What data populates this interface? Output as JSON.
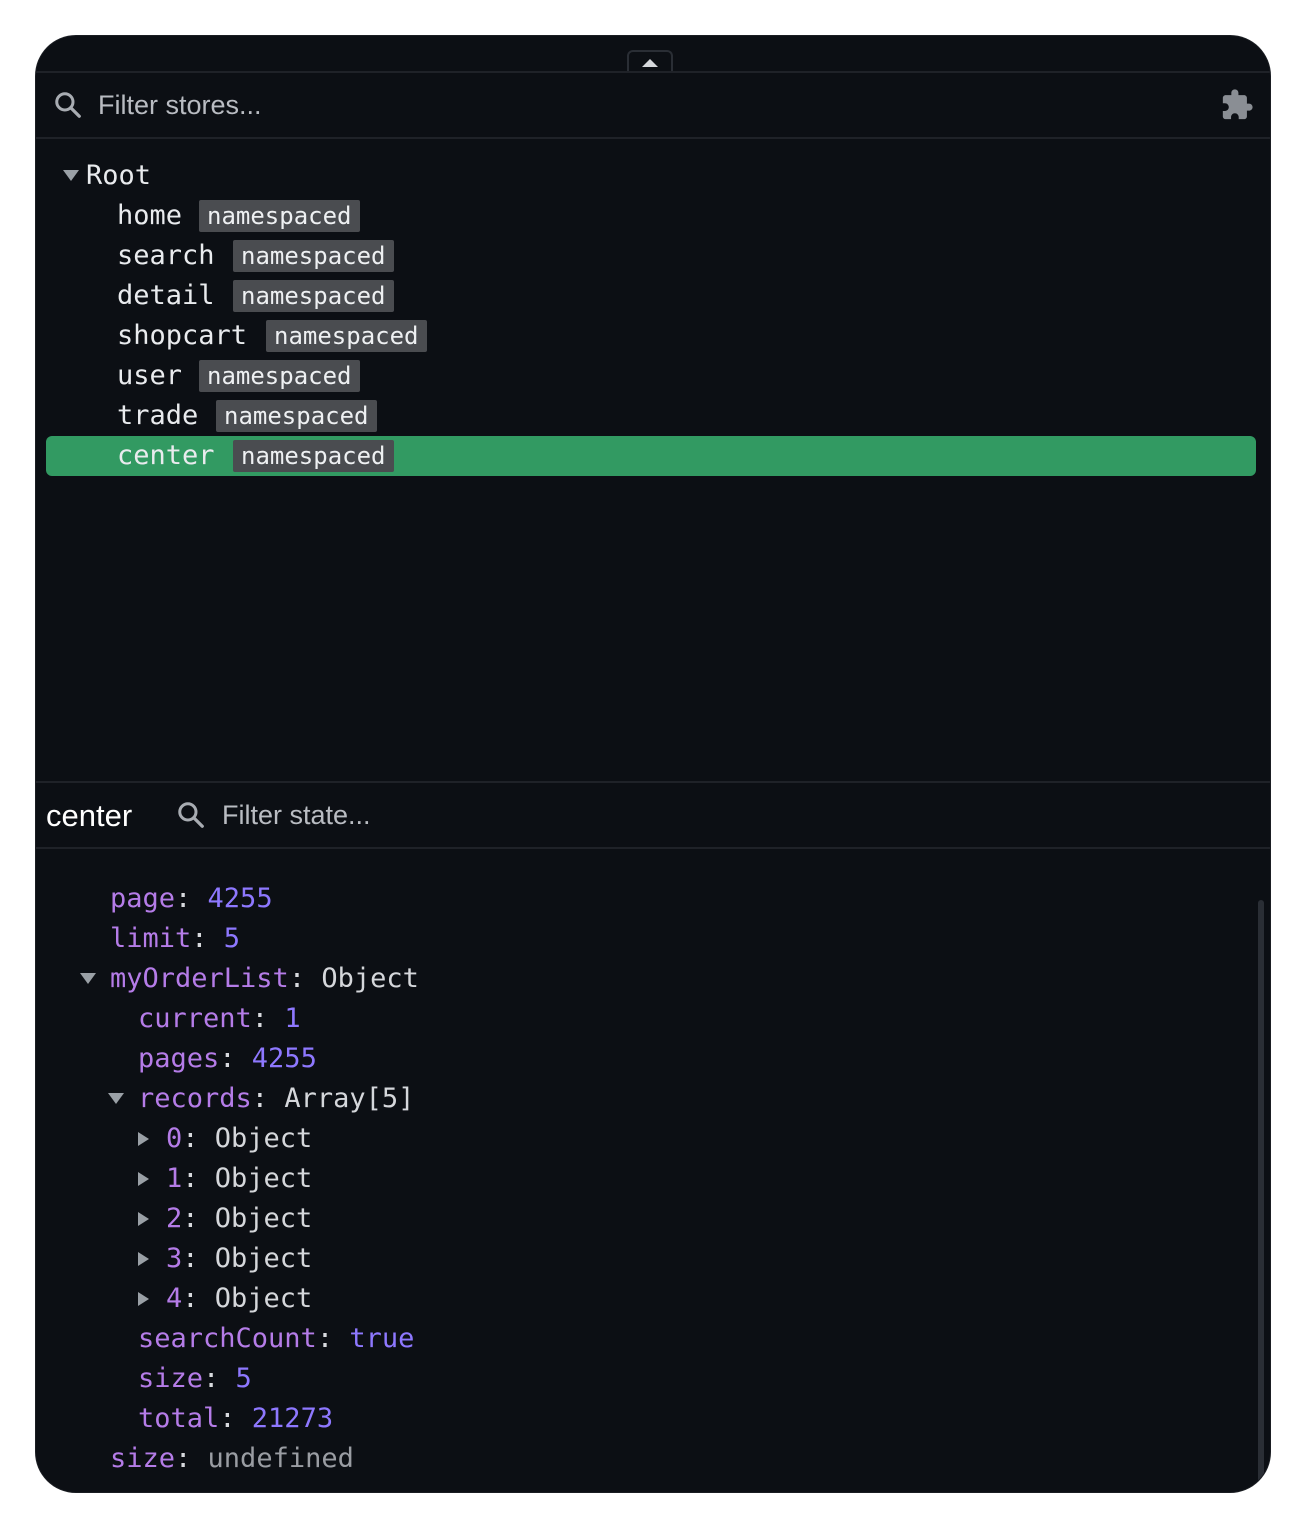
{
  "store_filter": {
    "placeholder": "Filter stores..."
  },
  "icons": {
    "search": "search-icon",
    "plugins": "puzzle-icon",
    "collapse": "chevron-up-icon"
  },
  "tree": {
    "root_label": "Root",
    "badge": "namespaced",
    "modules": [
      "home",
      "search",
      "detail",
      "shopcart",
      "user",
      "trade",
      "center"
    ],
    "selected": "center"
  },
  "state_header": {
    "title": "center",
    "placeholder": "Filter state..."
  },
  "state": {
    "page_key": "page",
    "page_value": "4255",
    "limit_key": "limit",
    "limit_value": "5",
    "myOrderList_key": "myOrderList",
    "myOrderList_type": "Object",
    "current_key": "current",
    "current_value": "1",
    "pages_key": "pages",
    "pages_value": "4255",
    "records_key": "records",
    "records_type": "Array[5]",
    "records_items": [
      {
        "key": "0",
        "type": "Object"
      },
      {
        "key": "1",
        "type": "Object"
      },
      {
        "key": "2",
        "type": "Object"
      },
      {
        "key": "3",
        "type": "Object"
      },
      {
        "key": "4",
        "type": "Object"
      }
    ],
    "searchCount_key": "searchCount",
    "searchCount_value": "true",
    "size_key": "size",
    "size_value": "5",
    "total_key": "total",
    "total_value": "21273",
    "size2_key": "size",
    "size2_value": "undefined"
  },
  "colors": {
    "selected_row": "#329a62",
    "key": "#b57ce8",
    "number": "#8e78ff",
    "background": "#0c0f14"
  }
}
